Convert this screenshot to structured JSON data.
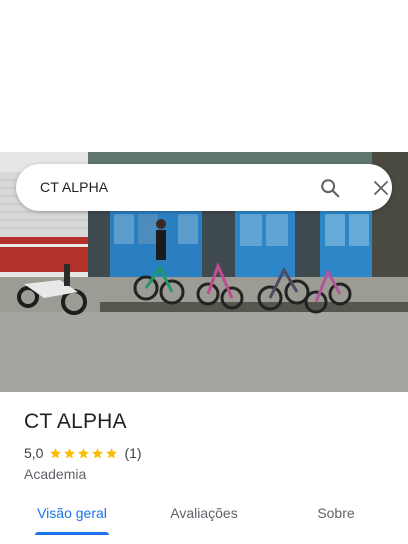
{
  "search": {
    "query": "CT ALPHA",
    "search_icon": "search-icon",
    "close_icon": "close-icon"
  },
  "place": {
    "name": "CT ALPHA",
    "rating": "5,0",
    "stars": 5,
    "reviews": "(1)",
    "category": "Academia"
  },
  "tabs": [
    {
      "label": "Visão geral",
      "active": true
    },
    {
      "label": "Avaliações",
      "active": false
    },
    {
      "label": "Sobre",
      "active": false
    }
  ],
  "colors": {
    "accent": "#1a73e8",
    "star": "#fbbc04",
    "text_primary": "#202124",
    "text_secondary": "#5f6368"
  }
}
